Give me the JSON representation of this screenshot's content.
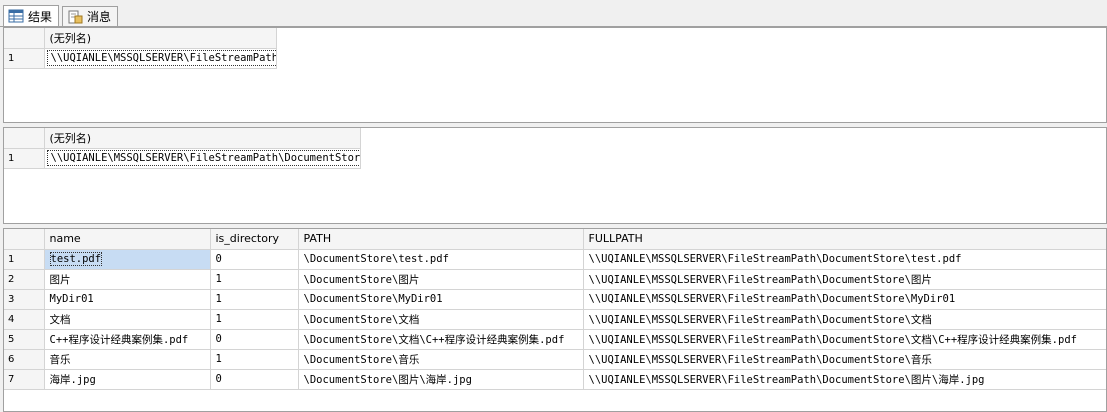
{
  "tabs": [
    {
      "label": "结果",
      "icon": "grid-icon",
      "active": true
    },
    {
      "label": "消息",
      "icon": "message-icon",
      "active": false
    }
  ],
  "result1": {
    "column": "(无列名)",
    "rows": [
      {
        "num": "1",
        "value": "\\\\UQIANLE\\MSSQLSERVER\\FileStreamPath"
      }
    ]
  },
  "result2": {
    "column": "(无列名)",
    "rows": [
      {
        "num": "1",
        "value": "\\\\UQIANLE\\MSSQLSERVER\\FileStreamPath\\DocumentStore"
      }
    ]
  },
  "result3": {
    "columns": [
      "name",
      "is_directory",
      "PATH",
      "FULLPATH"
    ],
    "rows": [
      {
        "num": "1",
        "name": "test.pdf",
        "is_directory": "0",
        "path": "\\DocumentStore\\test.pdf",
        "fullpath": "\\\\UQIANLE\\MSSQLSERVER\\FileStreamPath\\DocumentStore\\test.pdf"
      },
      {
        "num": "2",
        "name": "图片",
        "is_directory": "1",
        "path": "\\DocumentStore\\图片",
        "fullpath": "\\\\UQIANLE\\MSSQLSERVER\\FileStreamPath\\DocumentStore\\图片"
      },
      {
        "num": "3",
        "name": "MyDir01",
        "is_directory": "1",
        "path": "\\DocumentStore\\MyDir01",
        "fullpath": "\\\\UQIANLE\\MSSQLSERVER\\FileStreamPath\\DocumentStore\\MyDir01"
      },
      {
        "num": "4",
        "name": "文档",
        "is_directory": "1",
        "path": "\\DocumentStore\\文档",
        "fullpath": "\\\\UQIANLE\\MSSQLSERVER\\FileStreamPath\\DocumentStore\\文档"
      },
      {
        "num": "5",
        "name": "C++程序设计经典案例集.pdf",
        "is_directory": "0",
        "path": "\\DocumentStore\\文档\\C++程序设计经典案例集.pdf",
        "fullpath": "\\\\UQIANLE\\MSSQLSERVER\\FileStreamPath\\DocumentStore\\文档\\C++程序设计经典案例集.pdf"
      },
      {
        "num": "6",
        "name": "音乐",
        "is_directory": "1",
        "path": "\\DocumentStore\\音乐",
        "fullpath": "\\\\UQIANLE\\MSSQLSERVER\\FileStreamPath\\DocumentStore\\音乐"
      },
      {
        "num": "7",
        "name": "海岸.jpg",
        "is_directory": "0",
        "path": "\\DocumentStore\\图片\\海岸.jpg",
        "fullpath": "\\\\UQIANLE\\MSSQLSERVER\\FileStreamPath\\DocumentStore\\图片\\海岸.jpg"
      }
    ]
  },
  "colors": {
    "selection": "#c7dcf3",
    "border": "#a0a0a0"
  }
}
